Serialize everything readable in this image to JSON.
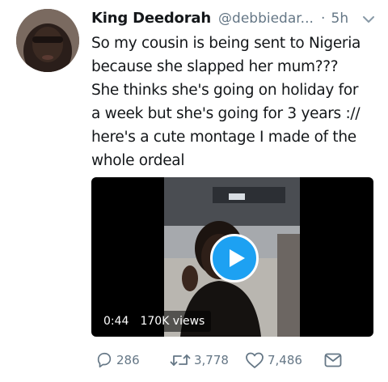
{
  "tweet": {
    "author_name": "King Deedorah",
    "handle": "@debbiedar...",
    "separator": "·",
    "time": "5h",
    "text": "So my cousin is being sent to Nigeria\nbecause she slapped her mum???\nShe thinks she's going on holiday for\na week but she's going for 3 years ://\nhere's a cute montage I made of the\nwhole ordeal"
  },
  "video": {
    "duration": "0:44",
    "views": "170K views"
  },
  "actions": {
    "replies": "286",
    "retweets": "3,778",
    "likes": "7,486"
  },
  "colors": {
    "accent": "#1da1f2",
    "muted": "#657786",
    "text": "#14171a"
  }
}
